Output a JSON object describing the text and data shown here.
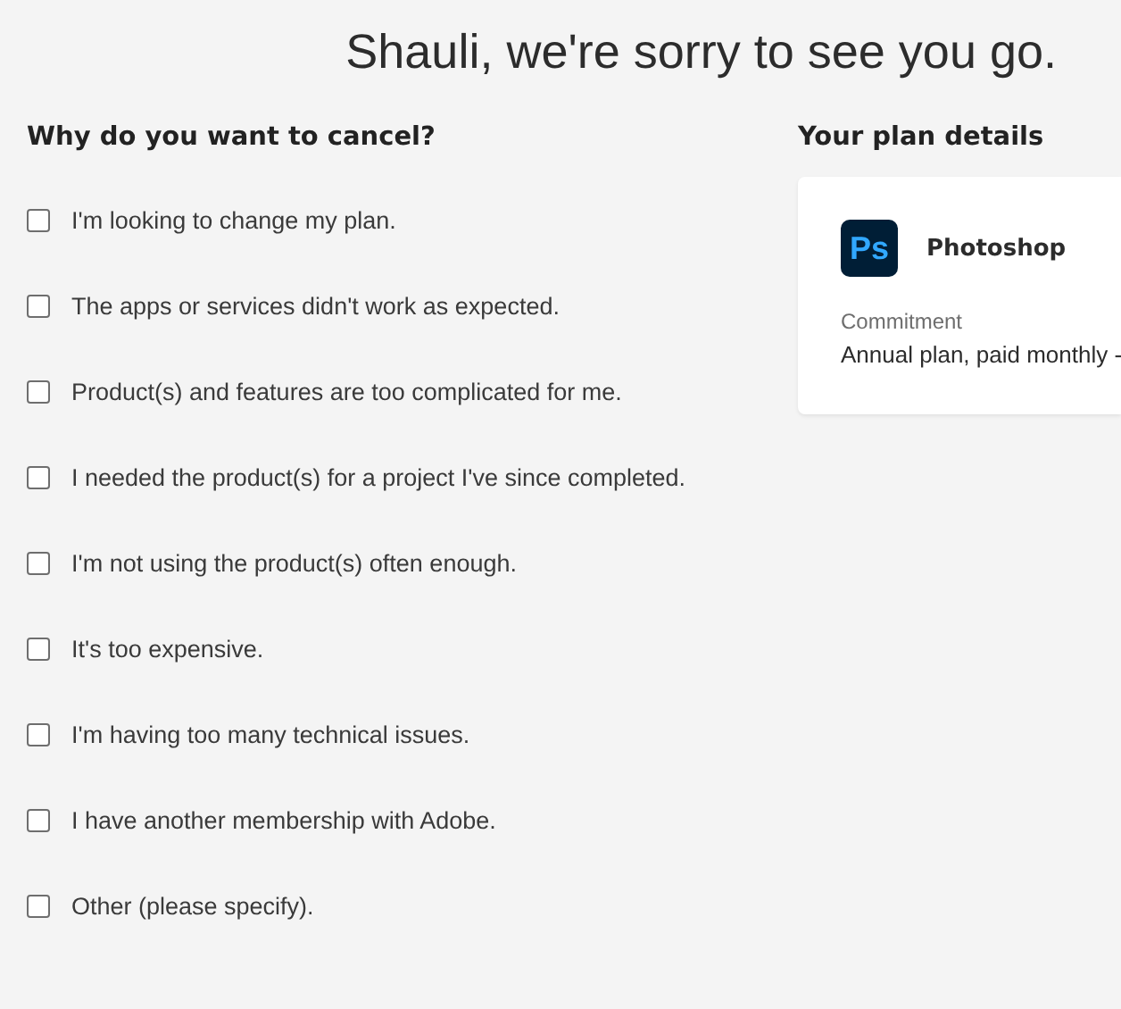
{
  "headline": "Shauli, we're sorry to see you go.",
  "reasons": {
    "title": "Why do you want to cancel?",
    "options": [
      {
        "label": "I'm looking to change my plan.",
        "checked": false
      },
      {
        "label": "The apps or services didn't work as expected.",
        "checked": false
      },
      {
        "label": "Product(s) and features are too complicated for me.",
        "checked": false
      },
      {
        "label": "I needed the product(s) for a project I've since completed.",
        "checked": false
      },
      {
        "label": "I'm not using the product(s) often enough.",
        "checked": false
      },
      {
        "label": "It's too expensive.",
        "checked": false
      },
      {
        "label": "I'm having too many technical issues.",
        "checked": false
      },
      {
        "label": "I have another membership with Adobe.",
        "checked": false
      },
      {
        "label": "Other (please specify).",
        "checked": false
      }
    ]
  },
  "plan": {
    "title": "Your plan details",
    "app_icon": "Ps",
    "app_name": "Photoshop",
    "commitment_label": "Commitment",
    "commitment_value": "Annual plan, paid monthly -"
  }
}
